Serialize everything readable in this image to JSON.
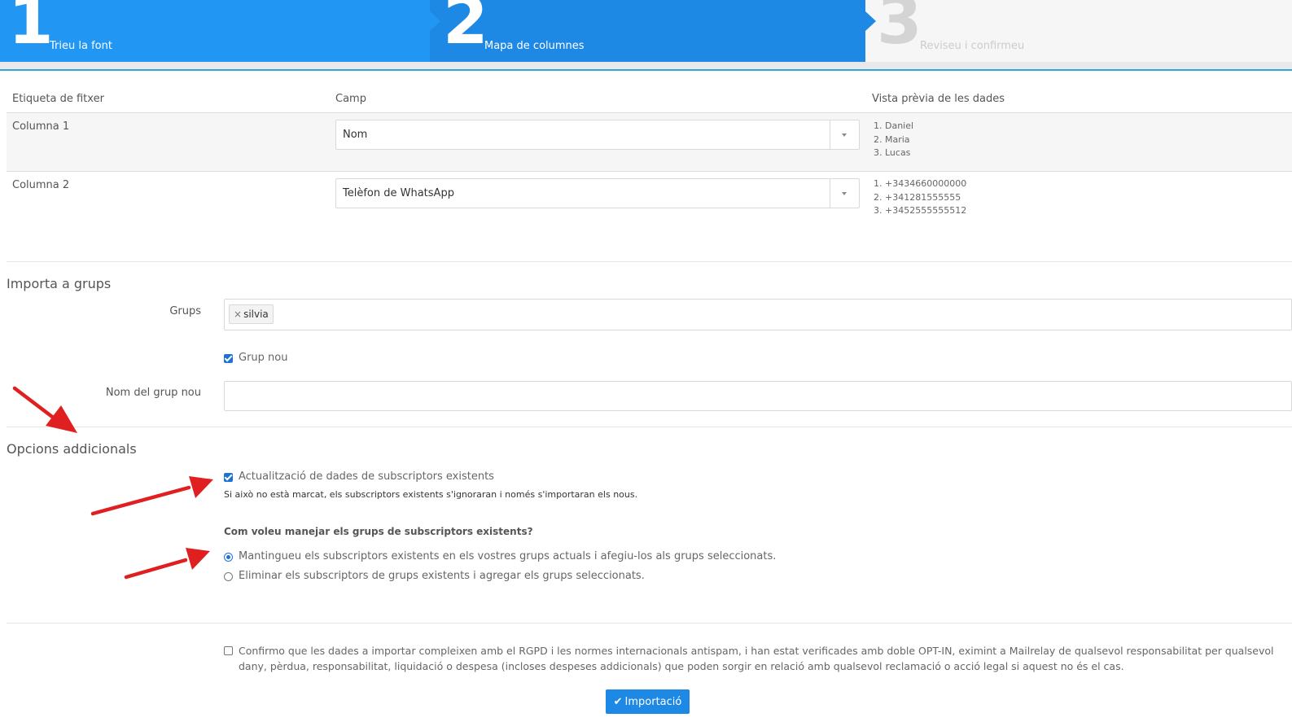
{
  "wizard": {
    "steps": [
      {
        "number": "1",
        "label": "Trieu la font"
      },
      {
        "number": "2",
        "label": "Mapa de columnes"
      },
      {
        "number": "3",
        "label": "Reviseu i confirmeu"
      }
    ]
  },
  "mapping": {
    "headers": {
      "file_label": "Etiqueta de fitxer",
      "field": "Camp",
      "preview": "Vista prèvia de les dades"
    },
    "rows": [
      {
        "label": "Columna 1",
        "field": "Nom",
        "preview": [
          "1. Daniel",
          "2. Maria",
          "3. Lucas"
        ]
      },
      {
        "label": "Columna 2",
        "field": "Telèfon de WhatsApp",
        "preview": [
          "1. +3434660000000",
          "2. +341281555555",
          "3. +3452555555512"
        ]
      }
    ]
  },
  "groups": {
    "title": "Importa a grups",
    "groups_label": "Grups",
    "tag_remove": "×",
    "tag": "silvia",
    "new_group_checkbox": "Grup nou",
    "new_group_name_label": "Nom del grup nou",
    "new_group_name_value": ""
  },
  "options": {
    "title": "Opcions addicionals",
    "update_checkbox": "Actualització de dades de subscriptors existents",
    "update_help": "Si això no està marcat, els subscriptors existents s'ignoraran i només s'importaran els nous.",
    "question": "Com voleu manejar els grups de subscriptors existents?",
    "radio_keep": "Mantingueu els subscriptors existents en els vostres grups actuals i afegiu-los als grups seleccionats.",
    "radio_remove": "Eliminar els subscriptors de grups existents i agregar els grups seleccionats."
  },
  "consent": {
    "text": "Confirmo que les dades a importar compleixen amb el RGPD i les normes internacionals antispam, i han estat verificades amb doble OPT-IN, eximint a Mailrelay de qualsevol responsabilitat per qualsevol dany, pèrdua, responsabilitat, liquidació o despesa (incloses despeses addicionals) que poden sorgir en relació amb qualsevol reclamació o acció legal si aquest no és el cas."
  },
  "submit": {
    "icon": "check-icon",
    "label": "Importació"
  },
  "colors": {
    "step_active": "#2196f3",
    "step_current": "#1e88e5",
    "step_inactive": "#f6f6f6",
    "accent": "#1e73d2",
    "annotation_arrow": "#e02020"
  }
}
